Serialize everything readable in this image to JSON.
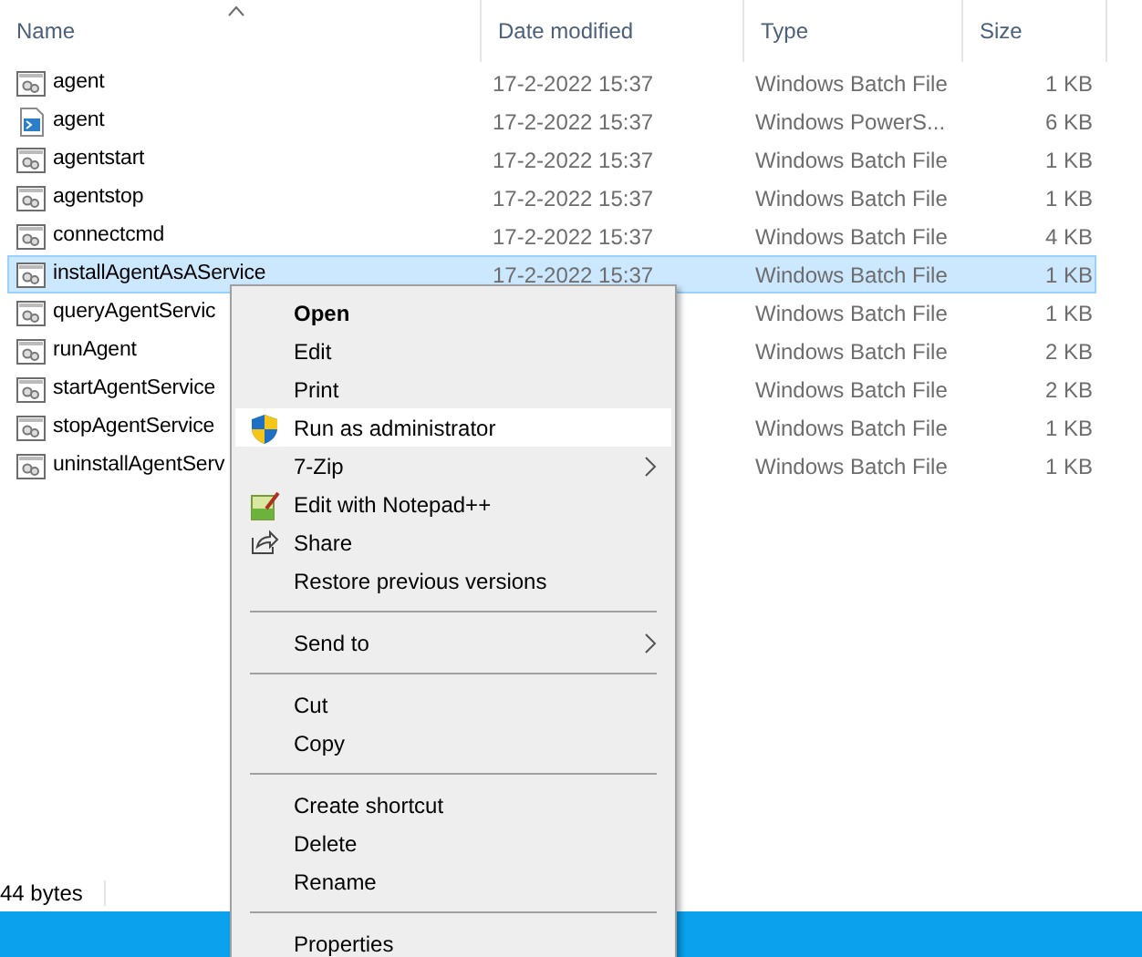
{
  "columns": [
    {
      "label": "Name",
      "sorted": true
    },
    {
      "label": "Date modified",
      "sorted": false
    },
    {
      "label": "Type",
      "sorted": false
    },
    {
      "label": "Size",
      "sorted": false
    }
  ],
  "files": [
    {
      "name": "agent",
      "kind": "batch",
      "date": "17-2-2022 15:37",
      "type": "Windows Batch File",
      "size": "1 KB",
      "selected": false
    },
    {
      "name": "agent",
      "kind": "powershell",
      "date": "17-2-2022 15:37",
      "type": "Windows PowerS...",
      "size": "6 KB",
      "selected": false
    },
    {
      "name": "agentstart",
      "kind": "batch",
      "date": "17-2-2022 15:37",
      "type": "Windows Batch File",
      "size": "1 KB",
      "selected": false
    },
    {
      "name": "agentstop",
      "kind": "batch",
      "date": "17-2-2022 15:37",
      "type": "Windows Batch File",
      "size": "1 KB",
      "selected": false
    },
    {
      "name": "connectcmd",
      "kind": "batch",
      "date": "17-2-2022 15:37",
      "type": "Windows Batch File",
      "size": "4 KB",
      "selected": false
    },
    {
      "name": "installAgentAsAService",
      "kind": "batch",
      "date": "17-2-2022 15:37",
      "type": "Windows Batch File",
      "size": "1 KB",
      "selected": true
    },
    {
      "name": "queryAgentServic",
      "kind": "batch",
      "type": "Windows Batch File",
      "size": "1 KB",
      "selected": false
    },
    {
      "name": "runAgent",
      "kind": "batch",
      "type": "Windows Batch File",
      "size": "2 KB",
      "selected": false
    },
    {
      "name": "startAgentService",
      "kind": "batch",
      "type": "Windows Batch File",
      "size": "2 KB",
      "selected": false
    },
    {
      "name": "stopAgentService",
      "kind": "batch",
      "type": "Windows Batch File",
      "size": "1 KB",
      "selected": false
    },
    {
      "name": "uninstallAgentServ",
      "kind": "batch",
      "type": "Windows Batch File",
      "size": "1 KB",
      "selected": false
    }
  ],
  "status_bar": {
    "text": "44 bytes"
  },
  "context_menu": [
    {
      "kind": "item",
      "label": "Open",
      "bold": true,
      "highlighted": false
    },
    {
      "kind": "item",
      "label": "Edit",
      "highlighted": false
    },
    {
      "kind": "item",
      "label": "Print",
      "highlighted": false
    },
    {
      "kind": "item",
      "label": "Run as administrator",
      "highlighted": true
    },
    {
      "kind": "item",
      "label": "7-Zip",
      "submenu": true,
      "highlighted": false
    },
    {
      "kind": "item",
      "label": "Edit with Notepad++",
      "highlighted": false
    },
    {
      "kind": "item",
      "label": "Share",
      "highlighted": false
    },
    {
      "kind": "item",
      "label": "Restore previous versions",
      "highlighted": false
    },
    {
      "kind": "separator"
    },
    {
      "kind": "item",
      "label": "Send to",
      "submenu": true,
      "highlighted": false
    },
    {
      "kind": "separator"
    },
    {
      "kind": "item",
      "label": "Cut",
      "highlighted": false
    },
    {
      "kind": "item",
      "label": "Copy",
      "highlighted": false
    },
    {
      "kind": "separator"
    },
    {
      "kind": "item",
      "label": "Create shortcut",
      "highlighted": false
    },
    {
      "kind": "item",
      "label": "Delete",
      "highlighted": false
    },
    {
      "kind": "item",
      "label": "Rename",
      "highlighted": false
    },
    {
      "kind": "separator"
    },
    {
      "kind": "item",
      "label": "Properties",
      "highlighted": false
    }
  ]
}
